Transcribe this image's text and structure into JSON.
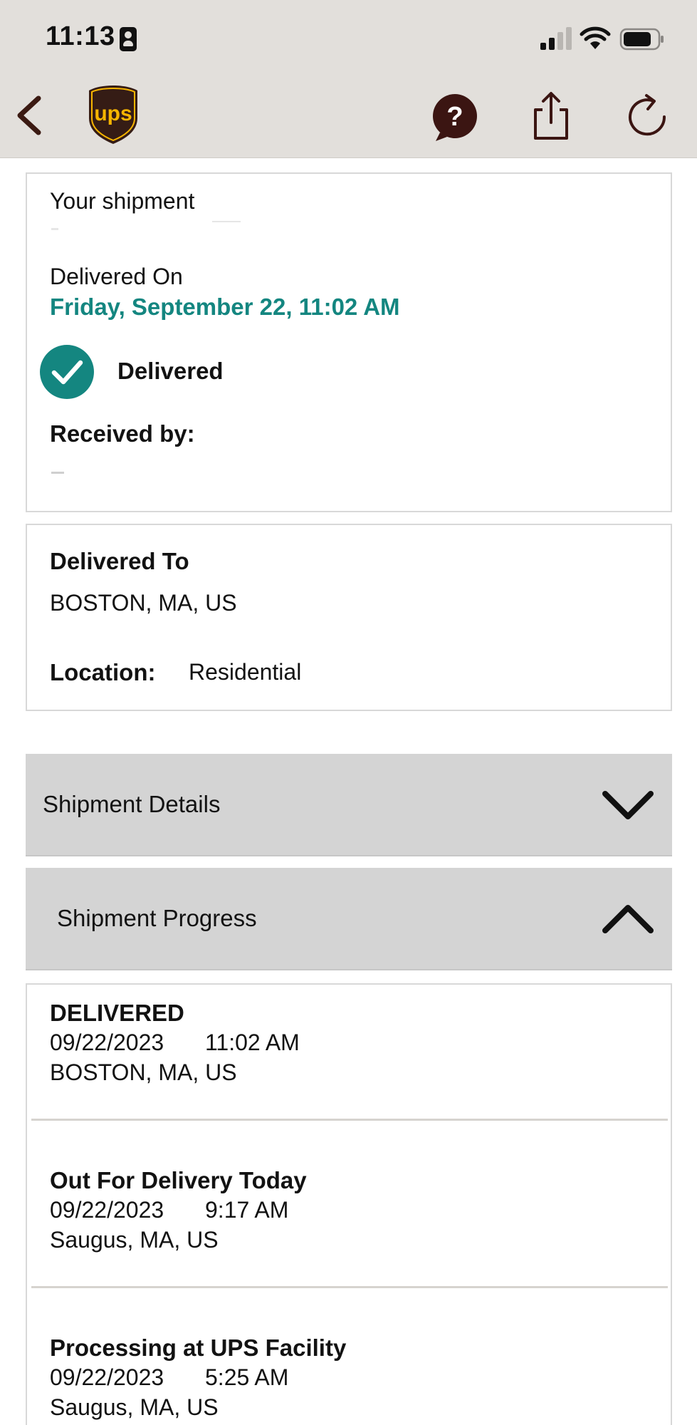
{
  "status_bar": {
    "time": "11:13"
  },
  "nav": {
    "back_icon": "chevron-left-icon",
    "logo_icon": "ups-shield-logo",
    "help_icon": "question-bubble-icon",
    "share_icon": "share-icon",
    "refresh_icon": "refresh-icon"
  },
  "status_card": {
    "heading": "Your shipment",
    "delivered_on_label": "Delivered On",
    "delivered_on_value": "Friday, September 22, 11:02 AM",
    "status_label": "Delivered",
    "received_by_label": "Received by:"
  },
  "destination_card": {
    "heading": "Delivered To",
    "address": "BOSTON, MA, US",
    "location_label": "Location:",
    "location_value": "Residential"
  },
  "accordions": {
    "details_label": "Shipment Details",
    "progress_label": "Shipment Progress"
  },
  "progress": [
    {
      "status": "DELIVERED",
      "date": "09/22/2023",
      "time": "11:02 AM",
      "place": "BOSTON, MA, US"
    },
    {
      "status": "Out For Delivery Today",
      "date": "09/22/2023",
      "time": "9:17 AM",
      "place": "Saugus, MA, US"
    },
    {
      "status": "Processing at UPS Facility",
      "date": "09/22/2023",
      "time": "5:25 AM",
      "place": "Saugus, MA, US"
    }
  ],
  "colors": {
    "header_bg": "#e2dfdb",
    "brand_brown": "#351c15",
    "brand_gold": "#f7b500",
    "accent_teal": "#148680",
    "accordion_bg": "#d4d4d4"
  }
}
